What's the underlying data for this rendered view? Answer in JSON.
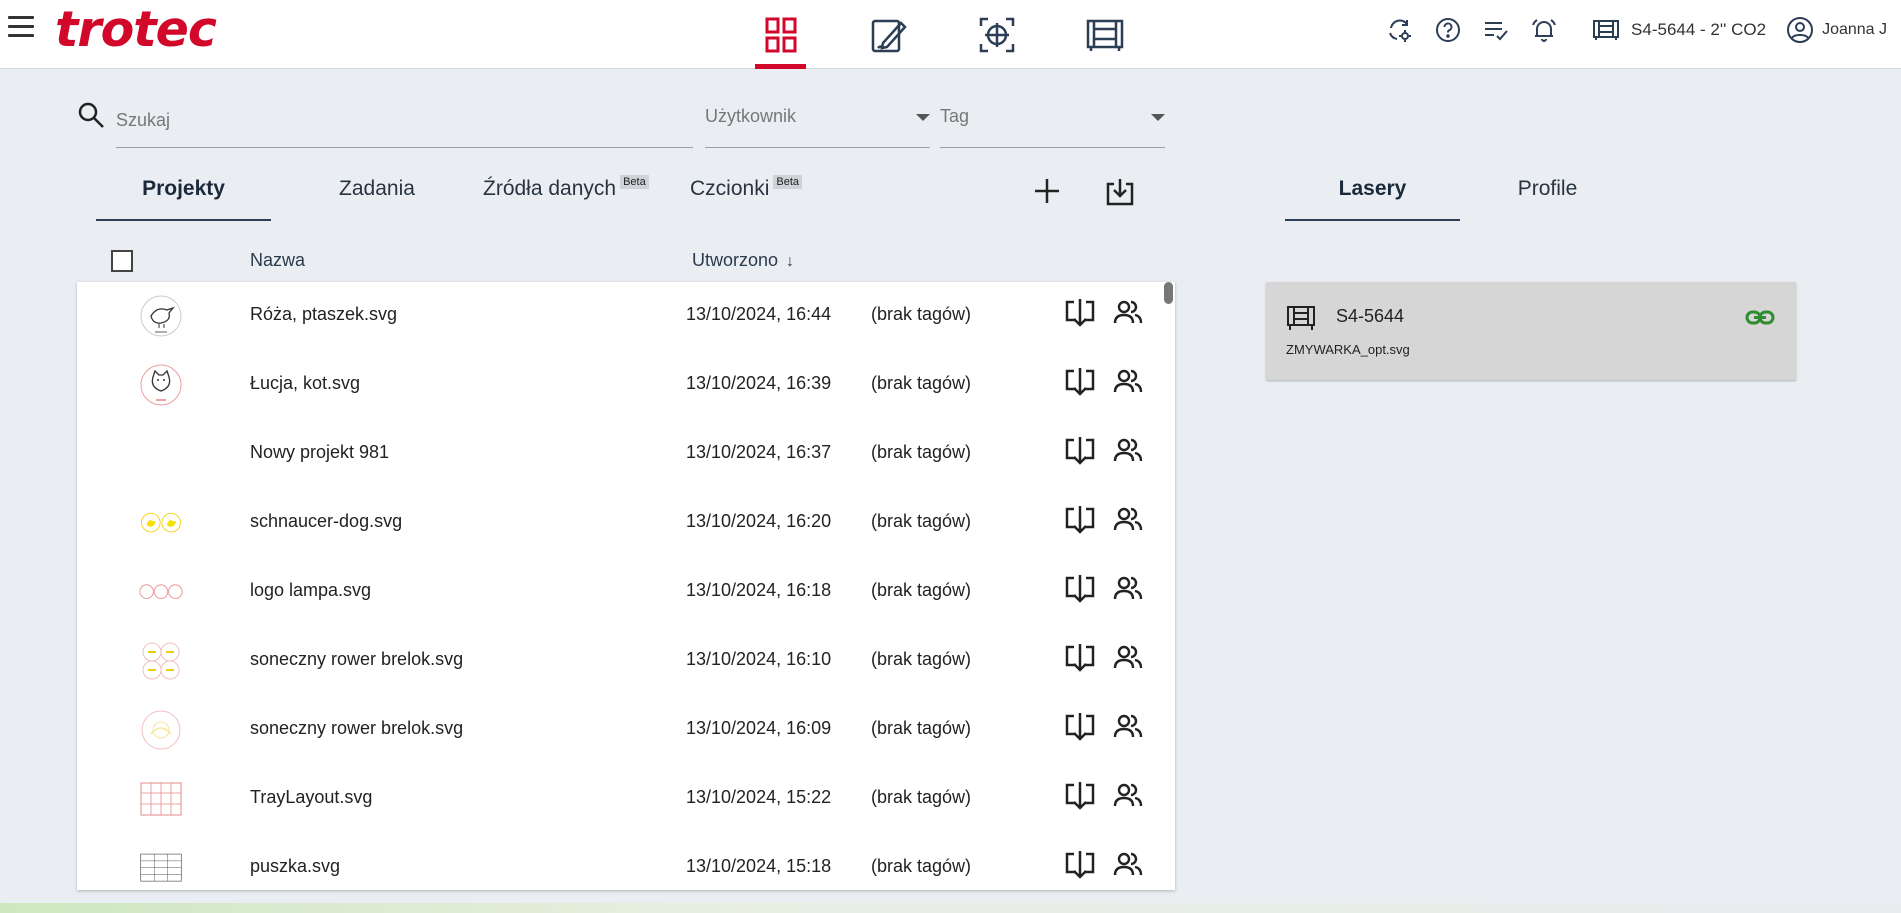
{
  "app": {
    "brand": "trotec",
    "brand_color": "#d2082b",
    "menu_icon": "hamburger-icon"
  },
  "nav_tabs": [
    {
      "icon": "grid-icon",
      "active": true
    },
    {
      "icon": "edit-icon",
      "active": false
    },
    {
      "icon": "crosshair-icon",
      "active": false
    },
    {
      "icon": "laser-machine-icon",
      "active": false
    }
  ],
  "header": {
    "icons": [
      "sync-settings-icon",
      "help-icon",
      "checklist-icon",
      "notification-bell-icon"
    ],
    "machine_label": "S4-5644 - 2'' CO2",
    "user_label": "Joanna J"
  },
  "filters": {
    "search_placeholder": "Szukaj",
    "user_select": "Użytkownik",
    "tag_select": "Tag"
  },
  "left_tabs": [
    {
      "label": "Projekty",
      "active": true
    },
    {
      "label": "Zadania",
      "active": false
    },
    {
      "label": "Źródła danych",
      "badge": "Beta",
      "active": false
    },
    {
      "label": "Czcionki",
      "badge": "Beta",
      "active": false
    }
  ],
  "table": {
    "col_name": "Nazwa",
    "col_created": "Utworzono",
    "sort_arrow": "↓",
    "rows": [
      {
        "thumb": "bird",
        "name": "Róża, ptaszek.svg",
        "date": "13/10/2024, 16:44",
        "tags": "(brak tagów)"
      },
      {
        "thumb": "cat",
        "name": "Łucja, kot.svg",
        "date": "13/10/2024, 16:39",
        "tags": "(brak tagów)"
      },
      {
        "thumb": "none",
        "name": "Nowy projekt 981",
        "date": "13/10/2024, 16:37",
        "tags": "(brak tagów)"
      },
      {
        "thumb": "yellow-ducks",
        "name": "schnaucer-dog.svg",
        "date": "13/10/2024, 16:20",
        "tags": "(brak tagów)"
      },
      {
        "thumb": "red-circles",
        "name": "logo lampa.svg",
        "date": "13/10/2024, 16:18",
        "tags": "(brak tagów)"
      },
      {
        "thumb": "yellow-grid",
        "name": "soneczny rower brelok.svg",
        "date": "13/10/2024, 16:10",
        "tags": "(brak tagów)"
      },
      {
        "thumb": "yellow-circle",
        "name": "soneczny rower brelok.svg",
        "date": "13/10/2024, 16:09",
        "tags": "(brak tagów)"
      },
      {
        "thumb": "red-grid",
        "name": "TrayLayout.svg",
        "date": "13/10/2024, 15:22",
        "tags": "(brak tagów)"
      },
      {
        "thumb": "table-lines",
        "name": "puszka.svg",
        "date": "13/10/2024, 15:18",
        "tags": "(brak tagów)"
      }
    ]
  },
  "right_tabs": [
    {
      "label": "Lasery",
      "active": true
    },
    {
      "label": "Profile",
      "active": false
    }
  ],
  "laser_card": {
    "name": "S4-5644",
    "file": "ZMYWARKA_opt.svg",
    "link_color": "#2e8b2e"
  }
}
